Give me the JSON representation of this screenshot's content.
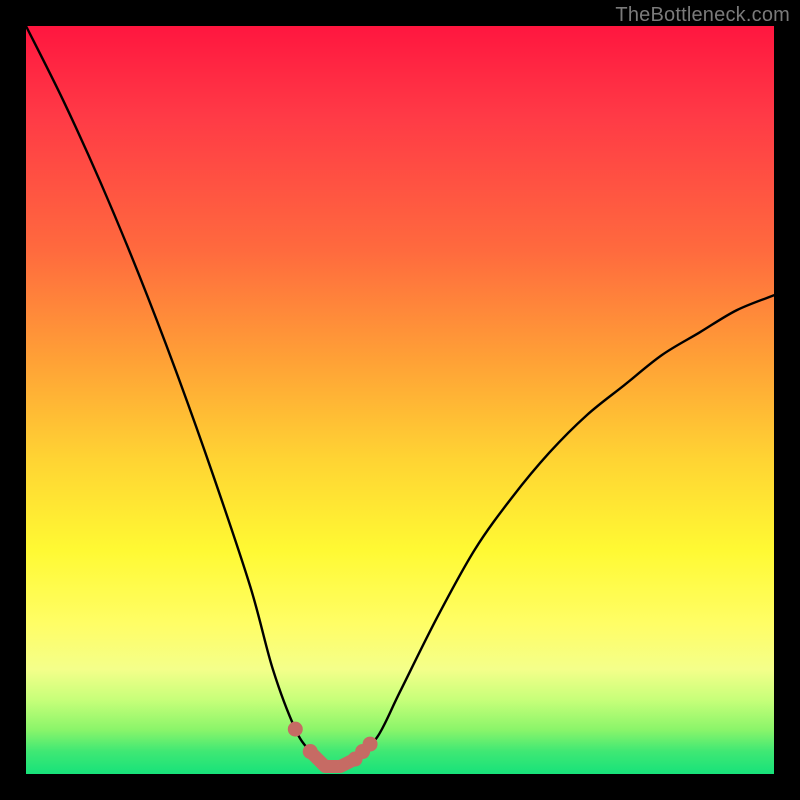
{
  "watermark": "TheBottleneck.com",
  "colors": {
    "background": "#000000",
    "curve": "#000000",
    "marker": "#c66b64",
    "gradient_top": "#ff163f",
    "gradient_bottom": "#17e27a"
  },
  "chart_data": {
    "type": "line",
    "title": "",
    "xlabel": "",
    "ylabel": "",
    "xlim": [
      0,
      100
    ],
    "ylim": [
      0,
      100
    ],
    "x": [
      0,
      5,
      10,
      15,
      20,
      25,
      30,
      33,
      36,
      38,
      40,
      42,
      44,
      47,
      50,
      55,
      60,
      65,
      70,
      75,
      80,
      85,
      90,
      95,
      100
    ],
    "y": [
      100,
      90,
      79,
      67,
      54,
      40,
      25,
      14,
      6,
      3,
      1,
      1,
      2,
      5,
      11,
      21,
      30,
      37,
      43,
      48,
      52,
      56,
      59,
      62,
      64
    ],
    "annotations": [
      {
        "text": "marker-left-dot",
        "x": 36,
        "y": 6
      },
      {
        "text": "marker-bottom-start",
        "x": 38,
        "y": 3
      },
      {
        "text": "marker-bottom-end",
        "x": 44,
        "y": 2
      },
      {
        "text": "marker-right-dot-1",
        "x": 45,
        "y": 3
      },
      {
        "text": "marker-right-dot-2",
        "x": 46,
        "y": 4
      }
    ]
  }
}
